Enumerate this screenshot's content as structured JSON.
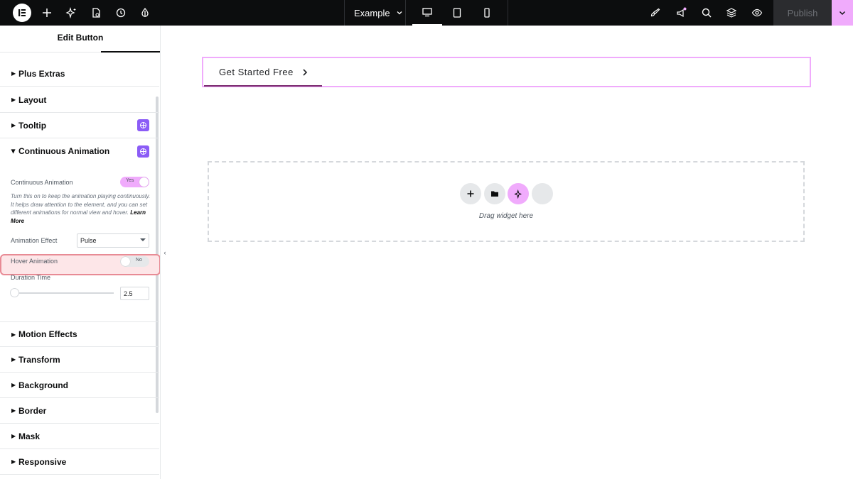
{
  "topbar": {
    "site_name": "Example",
    "publish_label": "Publish",
    "icons": [
      "elementor-logo",
      "add-icon",
      "ai-sparkle-icon",
      "page-settings-icon",
      "history-icon",
      "style-drop-icon",
      "theme-brush-icon",
      "notifications-icon",
      "search-icon",
      "layers-icon",
      "preview-eye-icon"
    ],
    "devices": [
      "desktop",
      "tablet",
      "mobile"
    ],
    "active_device": "desktop"
  },
  "panel": {
    "title": "Edit Button",
    "sections_top": [
      {
        "label": "Plus Extras",
        "pro": false
      },
      {
        "label": "Layout",
        "pro": false
      },
      {
        "label": "Tooltip",
        "pro": true
      },
      {
        "label": "Continuous Animation",
        "pro": true,
        "expanded": true
      }
    ],
    "continuous_animation": {
      "toggle_label": "Continuous Animation",
      "toggle_value": "Yes",
      "description": "Turn this on to keep the animation playing continuously. It helps draw attention to the element, and you can set different animations for normal view and hover.",
      "learn_more": "Learn More",
      "effect_label": "Animation Effect",
      "effect_value": "Pulse",
      "hover_label": "Hover Animation",
      "hover_value": "No",
      "duration_label": "Duration Time",
      "duration_value": "2.5"
    },
    "sections_bottom": [
      {
        "label": "Motion Effects"
      },
      {
        "label": "Transform"
      },
      {
        "label": "Background"
      },
      {
        "label": "Border"
      },
      {
        "label": "Mask"
      },
      {
        "label": "Responsive"
      }
    ]
  },
  "canvas": {
    "button_text": "Get Started Free",
    "drop_text": "Drag widget here"
  },
  "colors": {
    "accent": "#f0abfc",
    "pro_badge": "#8b5cf6",
    "highlight": "#e88b95"
  }
}
